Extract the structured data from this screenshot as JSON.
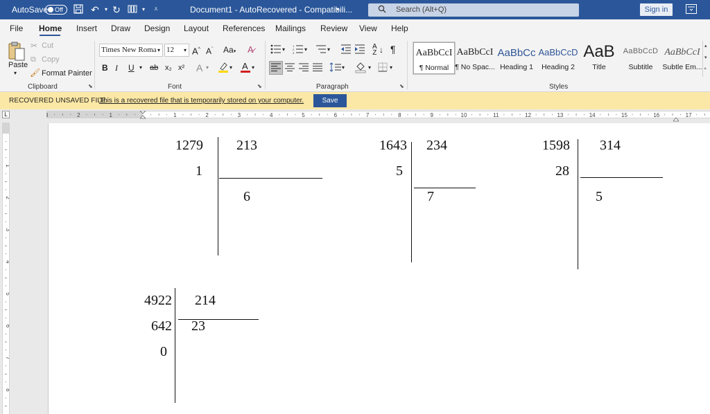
{
  "titlebar": {
    "autosave_label": "AutoSave",
    "autosave_state": "Off",
    "doc_title": "Document1  -  AutoRecovered  -  Compatibili...",
    "search_placeholder": "Search (Alt+Q)",
    "signin_label": "Sign in",
    "bg_color": "#2b579a"
  },
  "tabs": [
    "File",
    "Home",
    "Insert",
    "Draw",
    "Design",
    "Layout",
    "References",
    "Mailings",
    "Review",
    "View",
    "Help"
  ],
  "active_tab": "Home",
  "ribbon": {
    "clipboard": {
      "paste": "Paste",
      "cut": "Cut",
      "copy": "Copy",
      "format_painter": "Format Painter",
      "label": "Clipboard"
    },
    "font": {
      "name": "Times New Roma",
      "size": "12",
      "label": "Font",
      "bold": "B",
      "italic": "I",
      "underline": "U",
      "strike": "ab",
      "subscript": "x₂",
      "superscript": "x²",
      "case": "Aa"
    },
    "paragraph": {
      "label": "Paragraph"
    },
    "styles": {
      "label": "Styles",
      "items": [
        {
          "preview": "AaBbCcI",
          "name": "¶ Normal"
        },
        {
          "preview": "AaBbCcI",
          "name": "¶ No Spac..."
        },
        {
          "preview": "AaBbCc",
          "name": "Heading 1"
        },
        {
          "preview": "AaBbCcD",
          "name": "Heading 2"
        },
        {
          "preview": "AaB",
          "name": "Title"
        },
        {
          "preview": "AaBbCcD",
          "name": "Subtitle"
        },
        {
          "preview": "AaBbCcI",
          "name": "Subtle Em..."
        }
      ]
    }
  },
  "message_bar": {
    "title": "RECOVERED UNSAVED FILE",
    "text": "This is a recovered file that is temporarily stored on your computer.",
    "button": "Save"
  },
  "ruler": {
    "corner": "L",
    "h_labels": [
      "3",
      "2",
      "1",
      "1",
      "2",
      "3",
      "4",
      "5",
      "6",
      "7",
      "8",
      "9",
      "10",
      "11",
      "12",
      "13",
      "14",
      "15",
      "16",
      "17"
    ],
    "v_labels": [
      "1",
      "2",
      "3",
      "4",
      "5",
      "6",
      "7",
      "8"
    ]
  },
  "document": {
    "divisions": [
      {
        "dividend": "1279",
        "divisor": "213",
        "remainders": [
          "1"
        ],
        "quotient": "6"
      },
      {
        "dividend": "1643",
        "divisor": "234",
        "remainders": [
          "5"
        ],
        "quotient": "7"
      },
      {
        "dividend": "1598",
        "divisor": "314",
        "remainders": [
          "28"
        ],
        "quotient": "5"
      },
      {
        "dividend": "4922",
        "divisor": "214",
        "remainders": [
          "642",
          "0"
        ],
        "quotient": "23"
      }
    ]
  }
}
